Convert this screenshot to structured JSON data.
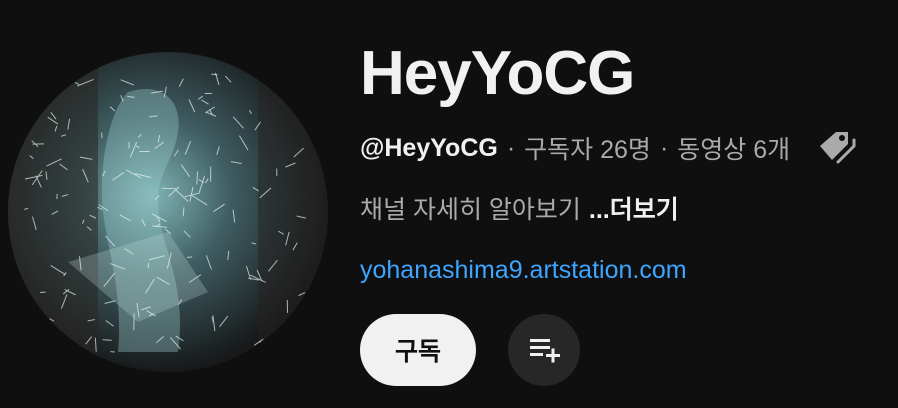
{
  "channel": {
    "name": "HeyYoCG",
    "handle": "@HeyYoCG",
    "separator": "·",
    "subscribers": "구독자 26명",
    "videos": "동영상 6개",
    "description": "채널 자세히 알아보기",
    "more_label": "...더보기",
    "link": "yohanashima9.artstation.com"
  },
  "actions": {
    "subscribe_label": "구독"
  },
  "icons": {
    "tag": "tag-icon",
    "playlist_add": "playlist-add-icon"
  },
  "colors": {
    "background": "#0f0f0f",
    "link": "#3ea6ff",
    "secondary_text": "#aaaaaa",
    "button_light": "#f1f1f1",
    "button_dark": "#272727"
  }
}
